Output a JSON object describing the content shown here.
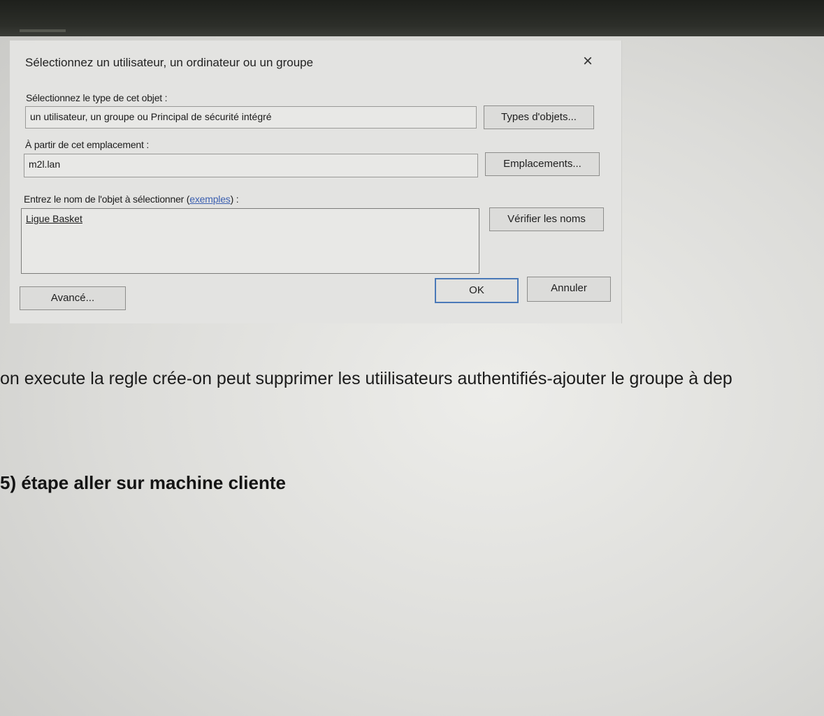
{
  "dialog": {
    "title": "Sélectionnez un utilisateur, un ordinateur ou un groupe",
    "close_icon": "×",
    "object_type_label": "Sélectionnez le type de cet objet :",
    "object_type_value": "un utilisateur, un groupe ou Principal de sécurité intégré",
    "object_types_button": "Types d'objets...",
    "location_label": "À partir de cet emplacement :",
    "location_value": "m2l.lan",
    "locations_button": "Emplacements...",
    "enter_name_label_prefix": "Entrez le nom de l'objet à sélectionner (",
    "enter_name_link": "exemples",
    "enter_name_label_suffix": ") :",
    "object_name_value": "Ligue Basket",
    "check_names_button": "Vérifier les noms",
    "advanced_button": "Avancé...",
    "ok_button": "OK",
    "cancel_button": "Annuler"
  },
  "document": {
    "line1": "on execute la regle crée-on peut supprimer les utiilisateurs authentifiés-ajouter le groupe à dep",
    "heading": "5) étape aller sur machine cliente"
  }
}
